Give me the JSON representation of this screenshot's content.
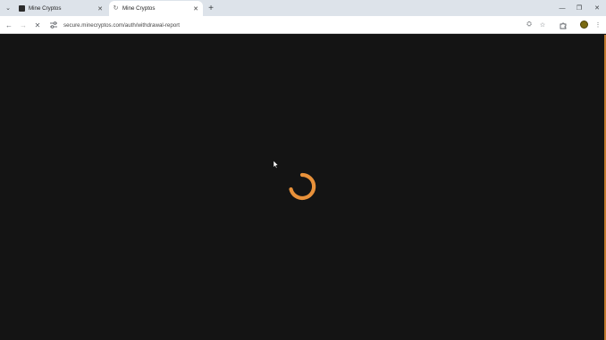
{
  "browser": {
    "tabs": [
      {
        "title": "Mine Cryptos",
        "active": false
      },
      {
        "title": "Mine Cryptos",
        "active": true
      }
    ],
    "url": "secure.minecryptos.com/auth/withdrawal-report",
    "icons": {
      "tab_search": "chevron-down-icon",
      "new_tab": "plus-icon",
      "back": "arrow-left-icon",
      "forward": "arrow-right-icon",
      "stop": "close-icon",
      "site_info": "tune-icon",
      "translate": "translate-icon",
      "bookmark": "star-icon",
      "extensions": "puzzle-icon",
      "menu": "kebab-menu-icon"
    }
  },
  "page": {
    "background_color": "#141414",
    "spinner_color": "#e8913a",
    "state": "loading"
  }
}
